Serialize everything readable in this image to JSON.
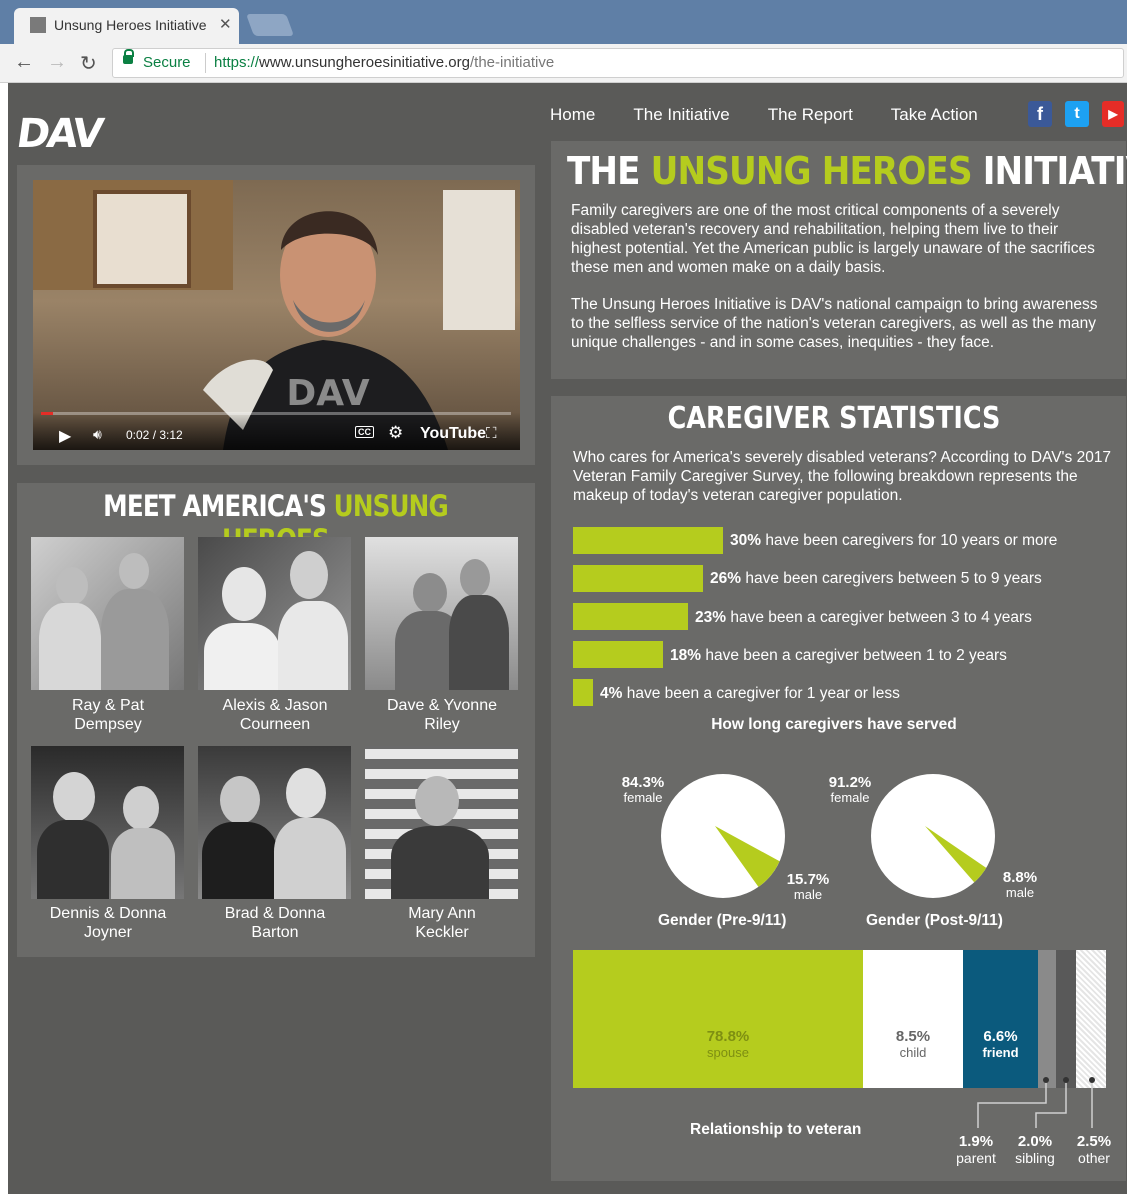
{
  "browser": {
    "tab_title": "Unsung Heroes Initiative",
    "secure_label": "Secure",
    "url_scheme": "https://",
    "url_host": "www.unsungheroesinitiative.org",
    "url_path": "/the-initiative"
  },
  "site": {
    "logo": "DAV",
    "nav": [
      "Home",
      "The Initiative",
      "The Report",
      "Take Action"
    ],
    "social_icons": [
      "facebook-icon",
      "twitter-icon",
      "youtube-icon"
    ]
  },
  "video": {
    "time": "0:02 / 3:12",
    "youtube_label": "YouTube",
    "shirt_logo": "DAV"
  },
  "meet": {
    "title_white": "MEET AMERICA'S",
    "title_green": "UNSUNG HEROES",
    "people": [
      {
        "line1": "Ray & Pat",
        "line2": "Dempsey"
      },
      {
        "line1": "Alexis & Jason",
        "line2": "Courneen"
      },
      {
        "line1": "Dave & Yvonne",
        "line2": "Riley"
      },
      {
        "line1": "Dennis & Donna",
        "line2": "Joyner"
      },
      {
        "line1": "Brad & Donna",
        "line2": "Barton"
      },
      {
        "line1": "Mary Ann",
        "line2": "Keckler"
      }
    ]
  },
  "initiative": {
    "title_1": "THE",
    "title_2": "UNSUNG HEROES",
    "title_3": "INITIATIVE",
    "para1": "Family caregivers are one of the most critical components of a severely disabled veteran's recovery and rehabilitation, helping them live to their highest potential. Yet the American public is largely unaware of the sacrifices these men and women make on a daily basis.",
    "para2": "The Unsung Heroes Initiative is DAV's national campaign to bring awareness to the selfless service of the nation's veteran caregivers, as well as the many unique challenges - and in some cases, inequities - they face."
  },
  "stats": {
    "title": "CAREGIVER STATISTICS",
    "intro": "Who cares for America's severely disabled veterans? According to DAV's 2017 Veteran Family Caregiver Survey, the following breakdown represents the makeup of today's veteran caregiver population.",
    "duration_caption": "How long caregivers have served",
    "durations": [
      {
        "pct": "30%",
        "text": "have been caregivers for 10 years or more"
      },
      {
        "pct": "26%",
        "text": "have been caregivers between 5 to 9 years"
      },
      {
        "pct": "23%",
        "text": "have been a caregiver between 3 to 4 years"
      },
      {
        "pct": "18%",
        "text": "have been a caregiver between 1 to 2 years"
      },
      {
        "pct": "4%",
        "text": "have been a caregiver for 1 year or less"
      }
    ],
    "gender_pre": {
      "female_pct": "84.3%",
      "female_label": "female",
      "male_pct": "15.7%",
      "male_label": "male",
      "caption": "Gender (Pre-9/11)"
    },
    "gender_post": {
      "female_pct": "91.2%",
      "female_label": "female",
      "male_pct": "8.8%",
      "male_label": "male",
      "caption": "Gender (Post-9/11)"
    },
    "relationship_caption": "Relationship to veteran",
    "relationship": [
      {
        "pct": "78.8%",
        "label": "spouse"
      },
      {
        "pct": "8.5%",
        "label": "child"
      },
      {
        "pct": "6.6%",
        "label": "friend"
      },
      {
        "pct": "1.9%",
        "label": "parent"
      },
      {
        "pct": "2.0%",
        "label": "sibling"
      },
      {
        "pct": "2.5%",
        "label": "other"
      }
    ]
  },
  "chart_data": [
    {
      "type": "bar",
      "title": "How long caregivers have served",
      "categories": [
        "10 years or more",
        "5 to 9 years",
        "3 to 4 years",
        "1 to 2 years",
        "1 year or less"
      ],
      "values": [
        30,
        26,
        23,
        18,
        4
      ]
    },
    {
      "type": "pie",
      "title": "Gender (Pre-9/11)",
      "categories": [
        "female",
        "male"
      ],
      "values": [
        84.3,
        15.7
      ]
    },
    {
      "type": "pie",
      "title": "Gender (Post-9/11)",
      "categories": [
        "female",
        "male"
      ],
      "values": [
        91.2,
        8.8
      ]
    },
    {
      "type": "bar",
      "title": "Relationship to veteran",
      "categories": [
        "spouse",
        "child",
        "friend",
        "parent",
        "sibling",
        "other"
      ],
      "values": [
        78.8,
        8.5,
        6.6,
        1.9,
        2.0,
        2.5
      ]
    }
  ]
}
